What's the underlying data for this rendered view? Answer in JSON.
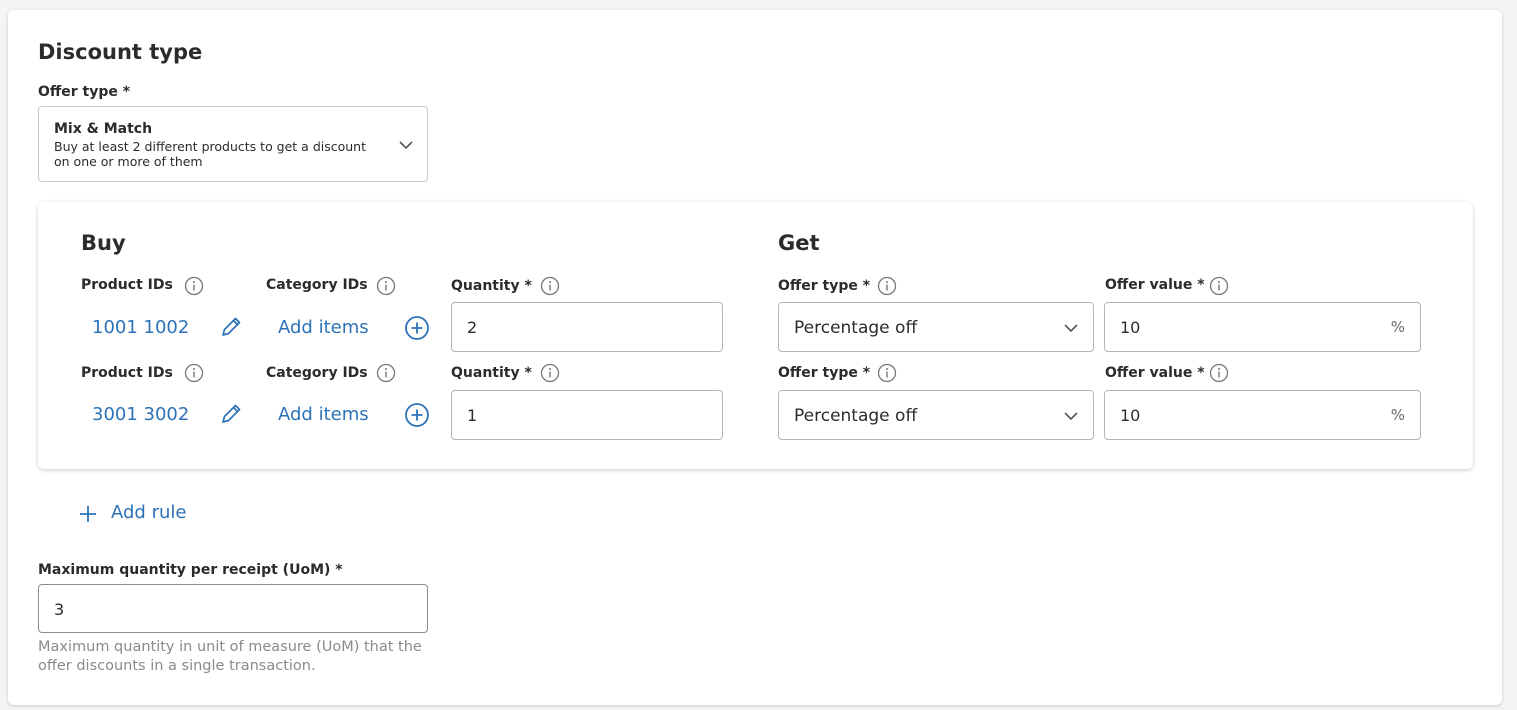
{
  "discount": {
    "title": "Discount type",
    "offer_type_label": "Offer type *",
    "offer_type_value": "Mix & Match",
    "offer_type_description": "Buy at least 2 different products to get a discount on one or more of them"
  },
  "buy": {
    "title": "Buy",
    "product_ids_label": "Product IDs",
    "category_ids_label": "Category IDs",
    "quantity_label": "Quantity *",
    "add_items_label": "Add items"
  },
  "get": {
    "title": "Get",
    "offer_type_label": "Offer type *",
    "offer_value_label": "Offer value *"
  },
  "rules": [
    {
      "product_ids": "1001 1002",
      "quantity": "2",
      "offer_type": "Percentage off",
      "offer_value": "10",
      "unit": "%"
    },
    {
      "product_ids": "3001 3002",
      "quantity": "1",
      "offer_type": "Percentage off",
      "offer_value": "10",
      "unit": "%"
    }
  ],
  "add_rule_label": "Add rule",
  "max_qty": {
    "label": "Maximum quantity per receipt (UoM) *",
    "value": "3",
    "hint": "Maximum quantity in unit of measure (UoM) that the offer discounts in a single transaction."
  },
  "colors": {
    "accent": "#2c72b8",
    "text": "#2b2b2b",
    "hint": "#8a8a8a"
  }
}
